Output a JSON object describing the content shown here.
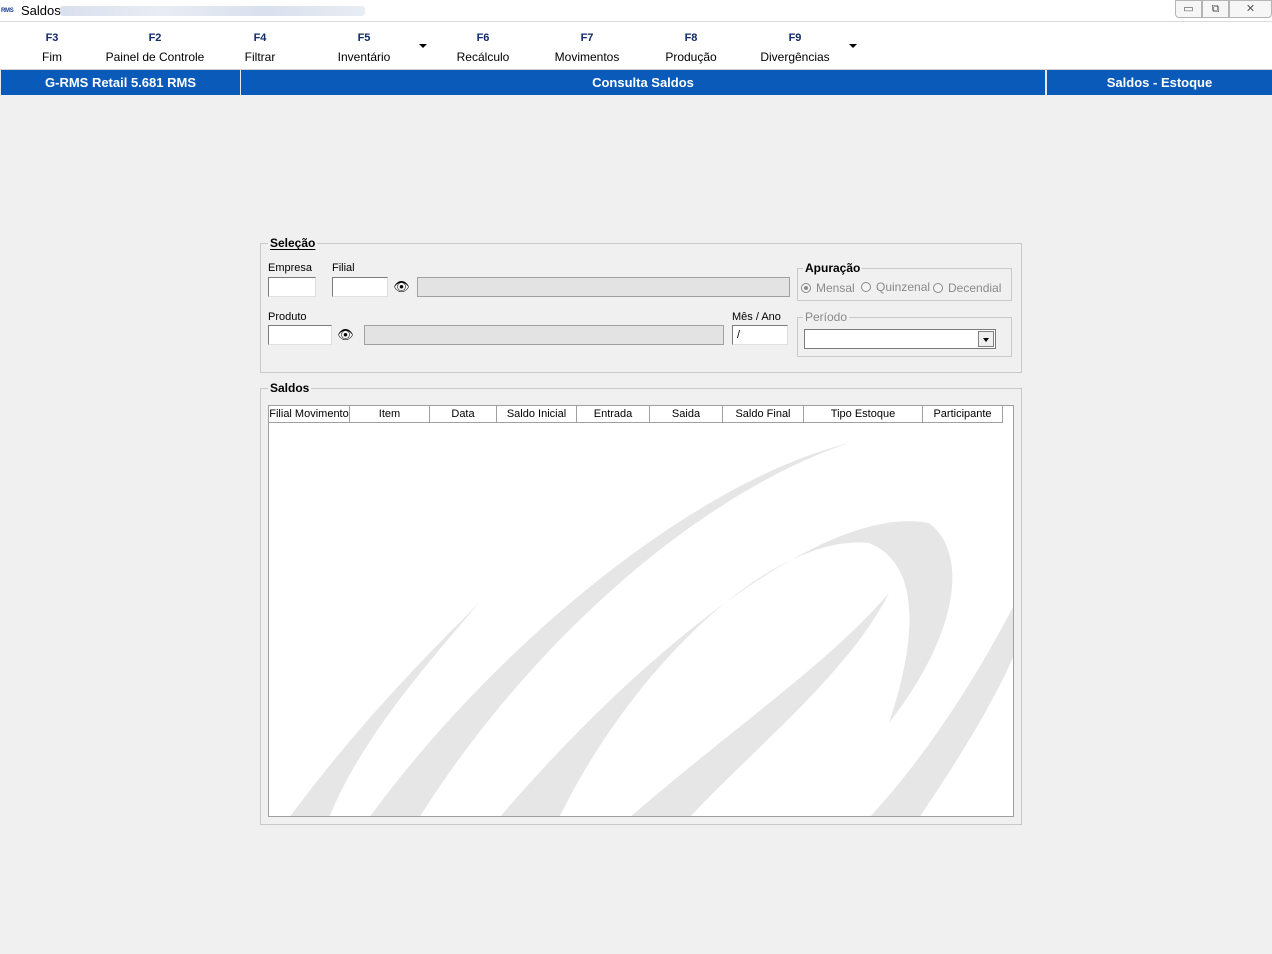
{
  "window": {
    "title": "Saldos",
    "app_icon_text": "RMS",
    "controls": {
      "minimize": "▭",
      "maximize": "⧉",
      "close": "✕"
    }
  },
  "toolbar": {
    "keys": [
      {
        "key": "F3",
        "label": "Fim"
      },
      {
        "key": "F2",
        "label": "Painel de Controle"
      },
      {
        "key": "F4",
        "label": "Filtrar"
      },
      {
        "key": "F5",
        "label": "Inventário"
      },
      {
        "key": "F6",
        "label": "Recálculo"
      },
      {
        "key": "F7",
        "label": "Movimentos"
      },
      {
        "key": "F8",
        "label": "Produção"
      },
      {
        "key": "F9",
        "label": "Divergências"
      }
    ]
  },
  "header": {
    "app": "G-RMS Retail 5.681 RMS",
    "screen": "Consulta Saldos",
    "module": "Saldos - Estoque"
  },
  "selecao": {
    "legend": "Seleção",
    "empresa_label": "Empresa",
    "empresa_value": "",
    "filial_label": "Filial",
    "filial_value": "",
    "produto_label": "Produto",
    "produto_value": "",
    "mes_ano_label": "Mês / Ano",
    "mes_ano_value": "/",
    "apuracao": {
      "legend": "Apuração",
      "options": [
        "Mensal",
        "Quinzenal",
        "Decendial"
      ],
      "selected": "Mensal"
    },
    "periodo": {
      "legend": "Período",
      "value": ""
    }
  },
  "saldos": {
    "legend": "Saldos",
    "columns": [
      "Filial Movimento",
      "Item",
      "Data",
      "Saldo Inicial",
      "Entrada",
      "Saida",
      "Saldo Final",
      "Tipo Estoque",
      "Participante"
    ],
    "rows": []
  },
  "colors": {
    "header_band": "#0a5ab9",
    "fkey_text": "#102a6a",
    "background": "#f0f0f0",
    "watermark": "#e6e6e6"
  }
}
